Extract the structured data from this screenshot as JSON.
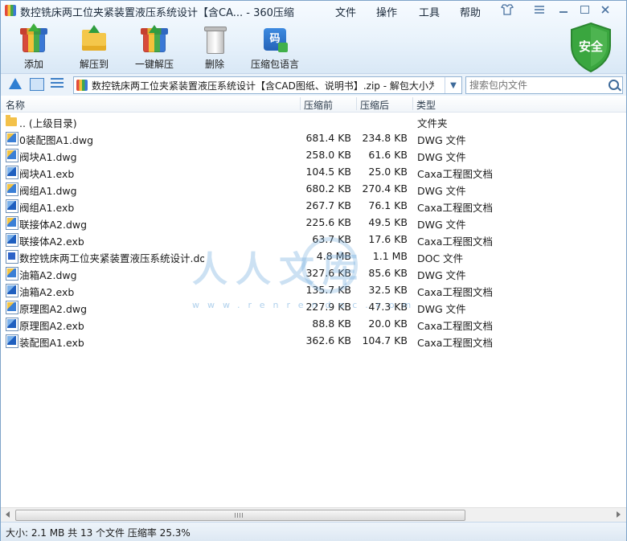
{
  "window": {
    "title": "数控铣床两工位夹紧装置液压系统设计【含CA... - 360压缩"
  },
  "menu": {
    "file": "文件",
    "operate": "操作",
    "tools": "工具",
    "help": "帮助"
  },
  "toolbar": {
    "add": "添加",
    "extract_to": "解压到",
    "one_key_extract": "一键解压",
    "delete": "删除",
    "archive_language": "压缩包语言",
    "lang_glyph": "码"
  },
  "security_badge": "安全",
  "address": {
    "path": "数控铣床两工位夹紧装置液压系统设计【含CAD图纸、说明书】.zip - 解包大小为"
  },
  "search": {
    "placeholder": "搜索包内文件"
  },
  "columns": {
    "name": "名称",
    "before": "压缩前",
    "after": "压缩后",
    "type": "类型"
  },
  "files": [
    {
      "name": ".. (上级目录)",
      "before": "",
      "after": "",
      "type": "文件夹",
      "icon": "folder-icon"
    },
    {
      "name": "0装配图A1.dwg",
      "before": "681.4 KB",
      "after": "234.8 KB",
      "type": "DWG 文件",
      "icon": "dwg-file-icon"
    },
    {
      "name": "阀块A1.dwg",
      "before": "258.0 KB",
      "after": "61.6 KB",
      "type": "DWG 文件",
      "icon": "dwg-file-icon"
    },
    {
      "name": "阀块A1.exb",
      "before": "104.5 KB",
      "after": "25.0 KB",
      "type": "Caxa工程图文档",
      "icon": "exb-file-icon"
    },
    {
      "name": "阀组A1.dwg",
      "before": "680.2 KB",
      "after": "270.4 KB",
      "type": "DWG 文件",
      "icon": "dwg-file-icon"
    },
    {
      "name": "阀组A1.exb",
      "before": "267.7 KB",
      "after": "76.1 KB",
      "type": "Caxa工程图文档",
      "icon": "exb-file-icon"
    },
    {
      "name": "联接体A2.dwg",
      "before": "225.6 KB",
      "after": "49.5 KB",
      "type": "DWG 文件",
      "icon": "dwg-file-icon"
    },
    {
      "name": "联接体A2.exb",
      "before": "63.7 KB",
      "after": "17.6 KB",
      "type": "Caxa工程图文档",
      "icon": "exb-file-icon"
    },
    {
      "name": "数控铣床两工位夹紧装置液压系统设计.doc",
      "before": "4.8 MB",
      "after": "1.1 MB",
      "type": "DOC 文件",
      "icon": "doc-file-icon"
    },
    {
      "name": "油箱A2.dwg",
      "before": "327.6 KB",
      "after": "85.6 KB",
      "type": "DWG 文件",
      "icon": "dwg-file-icon"
    },
    {
      "name": "油箱A2.exb",
      "before": "135.7 KB",
      "after": "32.5 KB",
      "type": "Caxa工程图文档",
      "icon": "exb-file-icon"
    },
    {
      "name": "原理图A2.dwg",
      "before": "227.9 KB",
      "after": "47.3 KB",
      "type": "DWG 文件",
      "icon": "dwg-file-icon"
    },
    {
      "name": "原理图A2.exb",
      "before": "88.8 KB",
      "after": "20.0 KB",
      "type": "Caxa工程图文档",
      "icon": "exb-file-icon"
    },
    {
      "name": "装配图A1.exb",
      "before": "362.6 KB",
      "after": "104.7 KB",
      "type": "Caxa工程图文档",
      "icon": "exb-file-icon"
    }
  ],
  "watermark": {
    "text": "人人文库",
    "url": "www.renrendoc.com"
  },
  "status": {
    "text": "大小: 2.1 MB 共 13 个文件 压缩率 25.3%"
  },
  "colors": {
    "accent": "#2f7fd2",
    "shield_green": "#3aa63f",
    "folder_yellow": "#f3c14a"
  }
}
